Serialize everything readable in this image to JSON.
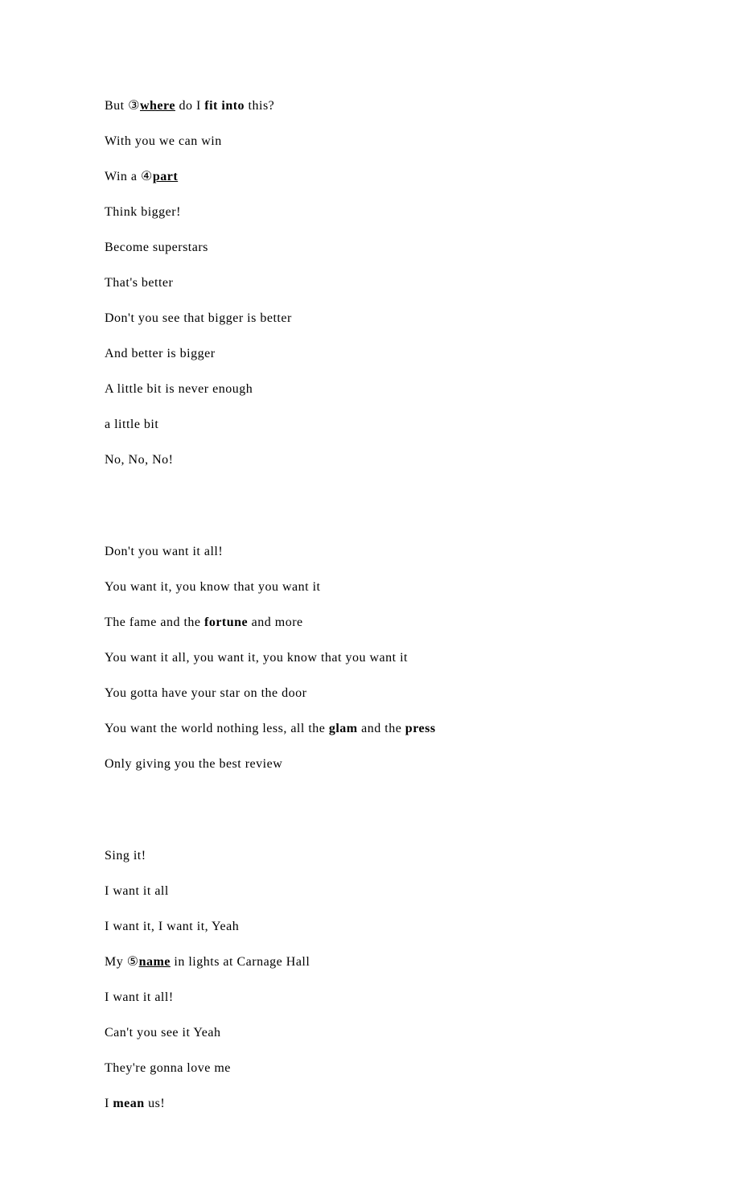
{
  "stanzas": [
    {
      "lines": [
        [
          {
            "text": "But "
          },
          {
            "text": "③",
            "bold": false,
            "classes": "circled"
          },
          {
            "text": "where",
            "bold": true,
            "underline": true
          },
          {
            "text": " do I "
          },
          {
            "text": "fit into",
            "bold": true
          },
          {
            "text": " this?"
          }
        ],
        [
          {
            "text": "With you we can win"
          }
        ],
        [
          {
            "text": "Win a "
          },
          {
            "text": "④",
            "classes": "circled"
          },
          {
            "text": "part",
            "bold": true,
            "underline": true
          }
        ],
        [
          {
            "text": "Think bigger!"
          }
        ],
        [
          {
            "text": "Become superstars"
          }
        ],
        [
          {
            "text": "That's better"
          }
        ],
        [
          {
            "text": "Don't you see that bigger is better"
          }
        ],
        [
          {
            "text": "And better is bigger"
          }
        ],
        [
          {
            "text": "A little bit is never enough"
          }
        ],
        [
          {
            "text": "a little bit"
          }
        ],
        [
          {
            "text": "No,  No,  No!"
          }
        ]
      ]
    },
    {
      "lines": [
        [
          {
            "text": "Don't you want it all!"
          }
        ],
        [
          {
            "text": "You want it,  you know that you want it"
          }
        ],
        [
          {
            "text": "The fame and the "
          },
          {
            "text": "fortune",
            "bold": true
          },
          {
            "text": " and more"
          }
        ],
        [
          {
            "text": "You want it all, you want it, you know that you want it"
          }
        ],
        [
          {
            "text": "You gotta have your star on the door"
          }
        ],
        [
          {
            "text": "You want the world nothing less, all the "
          },
          {
            "text": "glam",
            "bold": true
          },
          {
            "text": " and the "
          },
          {
            "text": "press",
            "bold": true
          }
        ],
        [
          {
            "text": "Only giving you the best review"
          }
        ]
      ]
    },
    {
      "lines": [
        [
          {
            "text": "Sing it!"
          }
        ],
        [
          {
            "text": "I want it all"
          }
        ],
        [
          {
            "text": "I want it, I want it,  Yeah"
          }
        ],
        [
          {
            "text": "My "
          },
          {
            "text": "⑤",
            "classes": "circled"
          },
          {
            "text": "name",
            "bold": true,
            "underline": true
          },
          {
            "text": " in lights at Carnage Hall"
          }
        ],
        [
          {
            "text": "I want it all!"
          }
        ],
        [
          {
            "text": "Can't you see it Yeah"
          }
        ],
        [
          {
            "text": "They're gonna love me"
          }
        ],
        [
          {
            "text": "I "
          },
          {
            "text": "mean",
            "bold": true
          },
          {
            "text": " us!"
          }
        ]
      ]
    }
  ]
}
